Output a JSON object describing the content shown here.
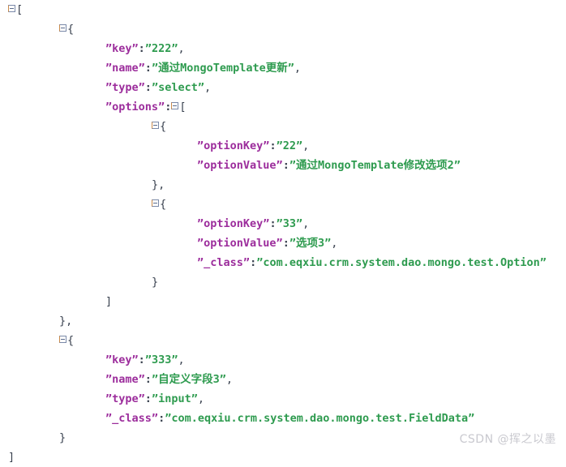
{
  "viewer": {
    "title": "JSON tree viewer",
    "background_color": "#ffffff",
    "key_color": "#9c2d9c",
    "value_color": "#2e9b4f",
    "punctuation_color": "#39414f",
    "toggle_icon": "minus-box"
  },
  "lines": [
    {
      "indent": 0,
      "toggle": true,
      "text": "["
    },
    {
      "indent": 1,
      "toggle": true,
      "text": "{"
    },
    {
      "indent": 2,
      "toggle": false,
      "key": "key",
      "value": "222",
      "comma": true
    },
    {
      "indent": 2,
      "toggle": false,
      "key": "name",
      "value": "通过MongoTemplate更新",
      "comma": true
    },
    {
      "indent": 2,
      "toggle": false,
      "key": "type",
      "value": "select",
      "comma": true
    },
    {
      "indent": 2,
      "toggle": false,
      "key": "options",
      "open_bracket": "[",
      "open_toggle": true
    },
    {
      "indent": 3,
      "toggle": true,
      "text": "{"
    },
    {
      "indent": 4,
      "toggle": false,
      "key": "optionKey",
      "value": "22",
      "comma": true
    },
    {
      "indent": 4,
      "toggle": false,
      "key": "optionValue",
      "value": "通过MongoTemplate修改选项2",
      "comma": false
    },
    {
      "indent": 3,
      "toggle": false,
      "text": "},"
    },
    {
      "indent": 3,
      "toggle": true,
      "text": "{"
    },
    {
      "indent": 4,
      "toggle": false,
      "key": "optionKey",
      "value": "33",
      "comma": true
    },
    {
      "indent": 4,
      "toggle": false,
      "key": "optionValue",
      "value": "选项3",
      "comma": true
    },
    {
      "indent": 4,
      "toggle": false,
      "key": "_class",
      "value": "com.eqxiu.crm.system.dao.mongo.test.Option",
      "comma": false
    },
    {
      "indent": 3,
      "toggle": false,
      "text": "}"
    },
    {
      "indent": 2,
      "toggle": false,
      "text": "]"
    },
    {
      "indent": 1,
      "toggle": false,
      "text": "},"
    },
    {
      "indent": 1,
      "toggle": true,
      "text": "{"
    },
    {
      "indent": 2,
      "toggle": false,
      "key": "key",
      "value": "333",
      "comma": true
    },
    {
      "indent": 2,
      "toggle": false,
      "key": "name",
      "value": "自定义字段3",
      "comma": true
    },
    {
      "indent": 2,
      "toggle": false,
      "key": "type",
      "value": "input",
      "comma": true
    },
    {
      "indent": 2,
      "toggle": false,
      "key": "_class",
      "value": "com.eqxiu.crm.system.dao.mongo.test.FieldData",
      "comma": false
    },
    {
      "indent": 1,
      "toggle": false,
      "text": "}"
    },
    {
      "indent": 0,
      "toggle": false,
      "text": "]"
    }
  ],
  "watermark": {
    "text": "CSDN @挥之以墨"
  }
}
